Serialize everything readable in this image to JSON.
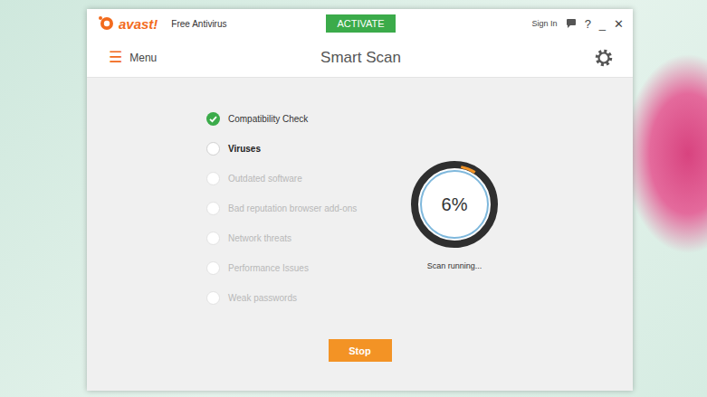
{
  "window": {
    "brand": "avast!",
    "product": "Free Antivirus"
  },
  "title_bar": {
    "activate": "ACTIVATE",
    "sign_in": "Sign In",
    "help": "?",
    "minimize": "_",
    "close": "✕"
  },
  "header": {
    "menu_icon": "☰",
    "menu": "Menu",
    "title": "Smart Scan"
  },
  "steps": [
    {
      "label": "Compatibility Check",
      "done": true,
      "current": false
    },
    {
      "label": "Viruses",
      "done": false,
      "current": true
    },
    {
      "label": "Outdated software",
      "done": false,
      "current": false
    },
    {
      "label": "Bad reputation browser add-ons",
      "done": false,
      "current": false
    },
    {
      "label": "Network threats",
      "done": false,
      "current": false
    },
    {
      "label": "Performance Issues",
      "done": false,
      "current": false
    },
    {
      "label": "Weak passwords",
      "done": false,
      "current": false
    }
  ],
  "progress": {
    "reading": "6%",
    "level": 0.06,
    "status": "Scan running..."
  },
  "buttons": [
    "Stop"
  ]
}
